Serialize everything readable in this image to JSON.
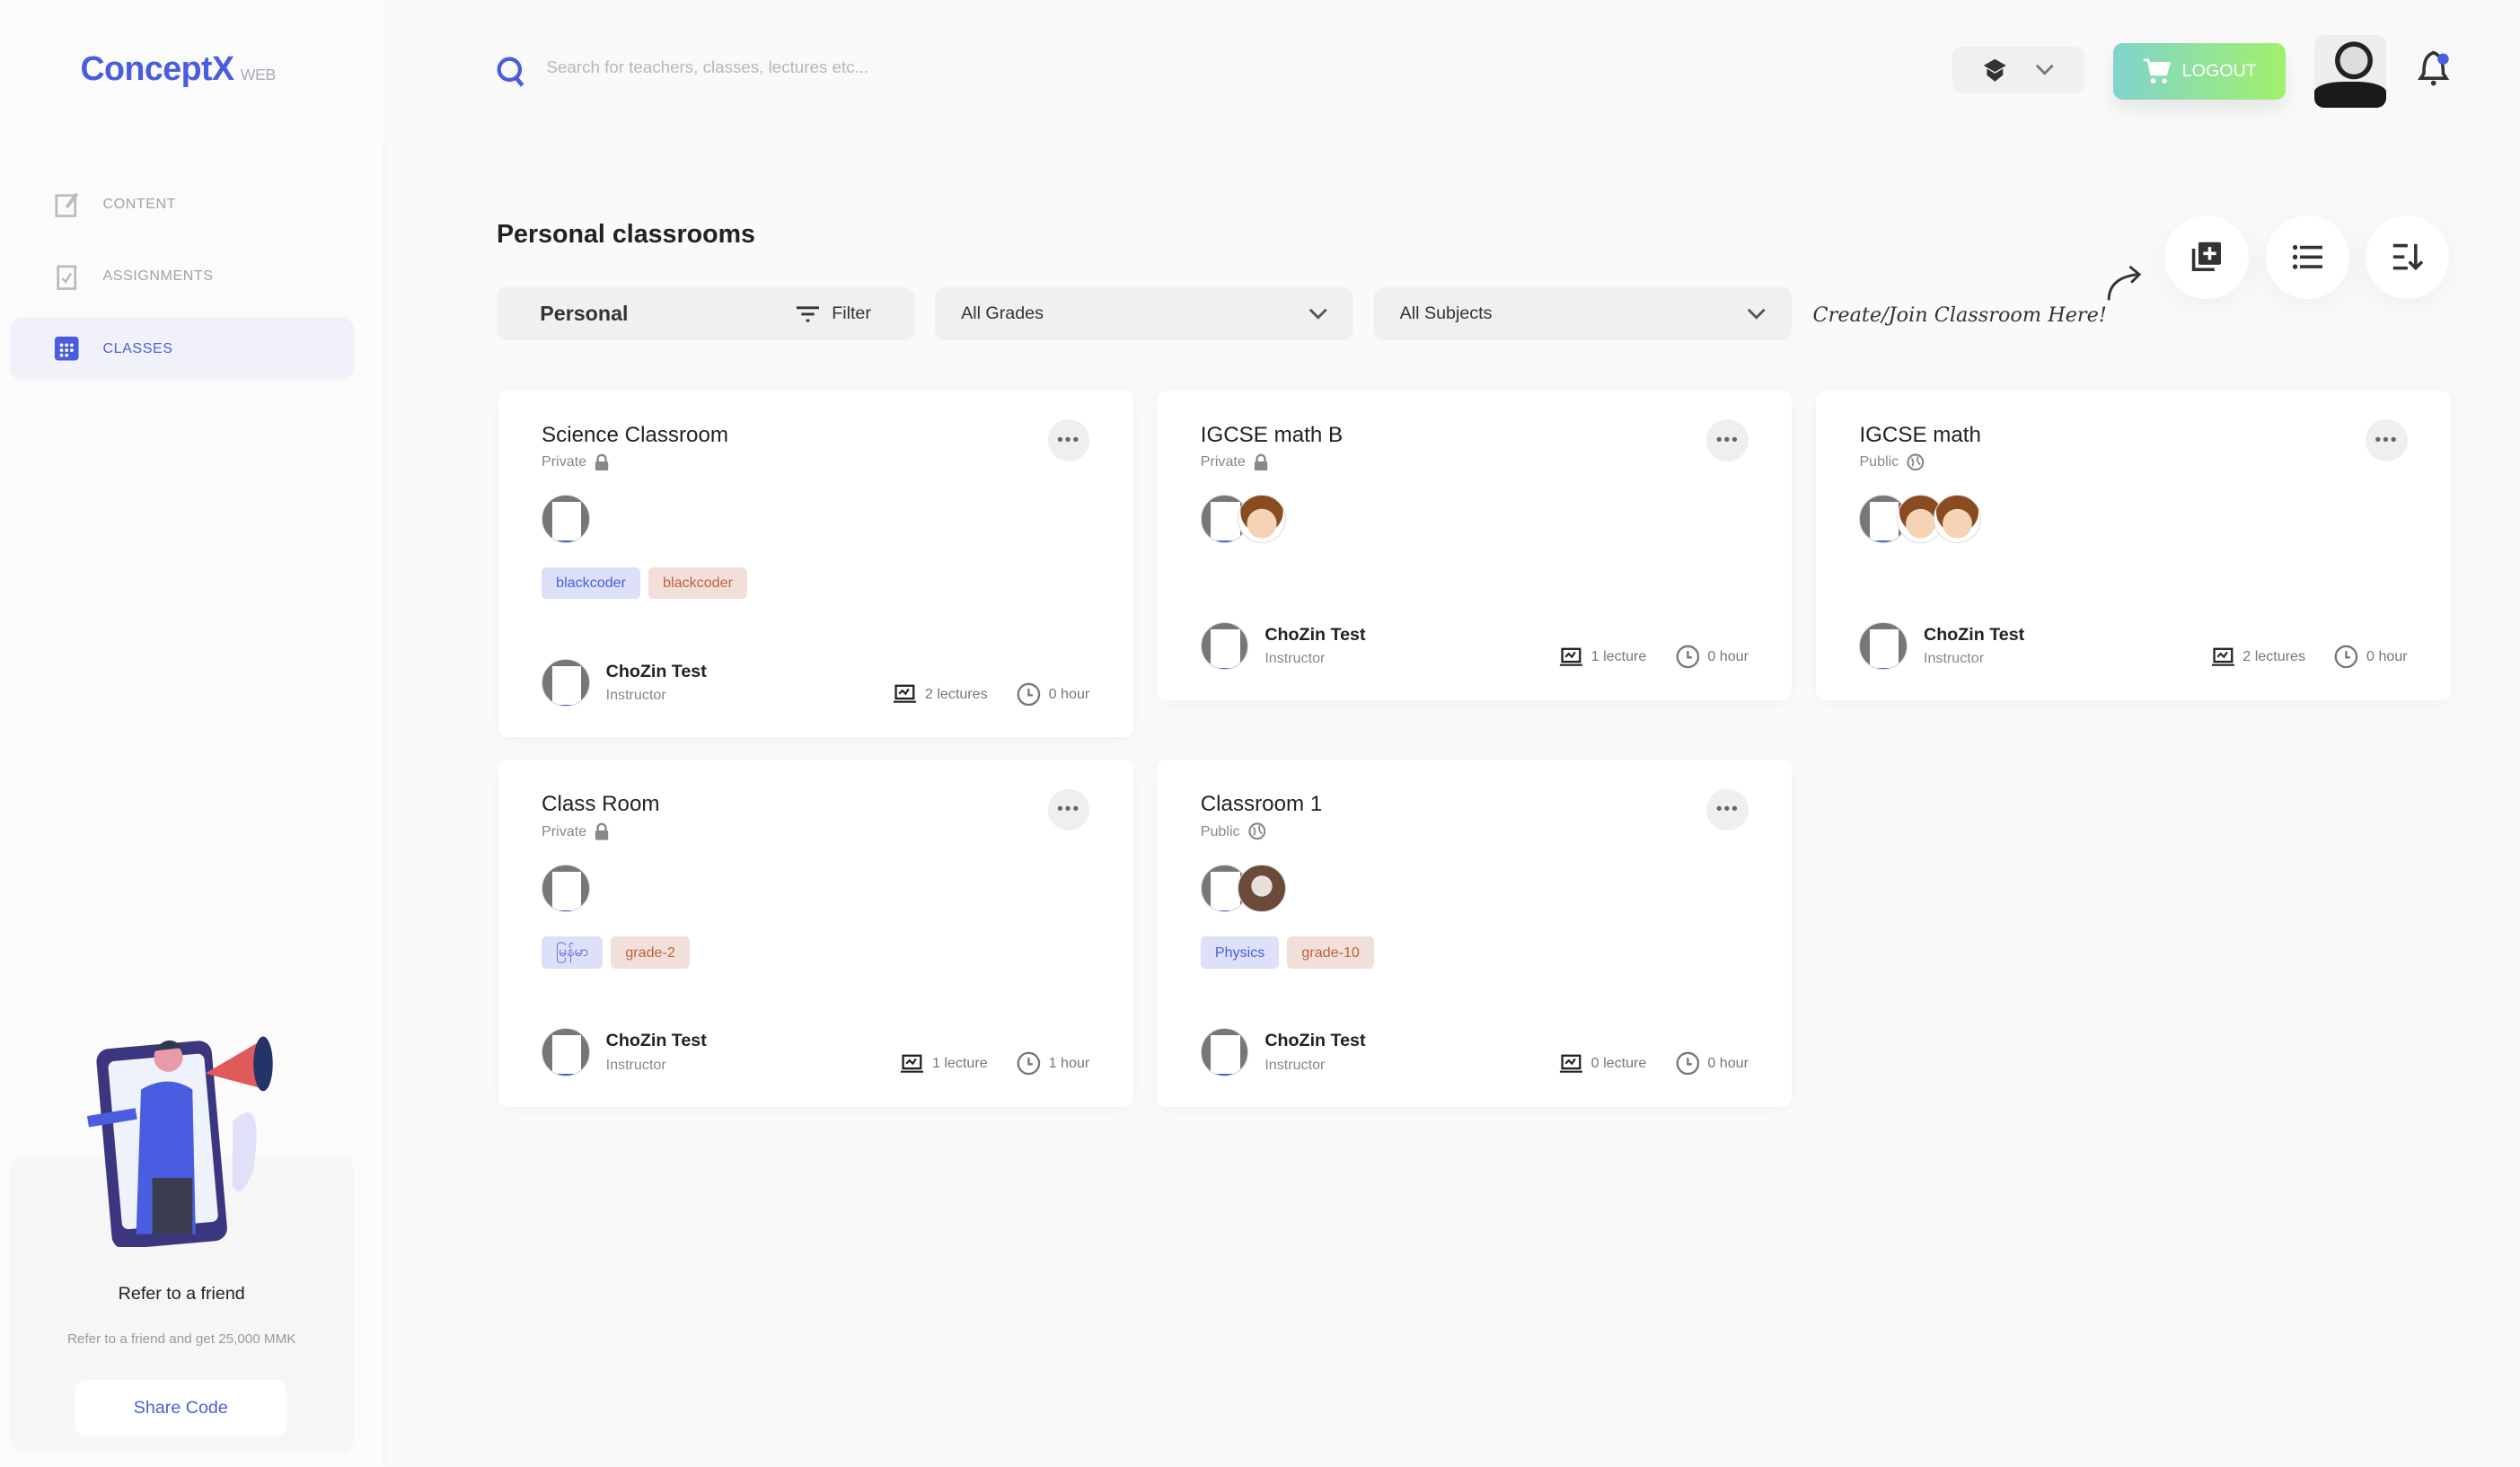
{
  "brand": {
    "name": "ConceptX",
    "suffix": "WEB"
  },
  "sidebar": {
    "items": [
      {
        "label": "CONTENT"
      },
      {
        "label": "ASSIGNMENTS"
      },
      {
        "label": "CLASSES",
        "active": true
      }
    ],
    "refer": {
      "title": "Refer to a friend",
      "subtitle": "Refer to a friend and get 25,000 MMK",
      "button": "Share Code"
    }
  },
  "header": {
    "search_placeholder": "Search for teachers, classes, lectures etc...",
    "logout": "LOGOUT"
  },
  "main": {
    "title": "Personal classrooms",
    "filter": {
      "scope": "Personal",
      "filter_label": "Filter",
      "grades": "All Grades",
      "subjects": "All Subjects"
    },
    "hint": "Create/Join Classroom Here!",
    "cards": [
      {
        "title": "Science Classroom",
        "visibility": "Private",
        "avatars": [
          "shot"
        ],
        "tags": [
          {
            "text": "blackcoder",
            "color": "blue"
          },
          {
            "text": "blackcoder",
            "color": "red"
          }
        ],
        "instructor": "ChoZin Test",
        "role": "Instructor",
        "lectures": "2 lectures",
        "hours": "0 hour"
      },
      {
        "title": "IGCSE math B",
        "visibility": "Private",
        "avatars": [
          "shot",
          "face"
        ],
        "tags": [],
        "instructor": "ChoZin Test",
        "role": "Instructor",
        "lectures": "1 lecture",
        "hours": "0 hour"
      },
      {
        "title": "IGCSE math",
        "visibility": "Public",
        "avatars": [
          "shot",
          "face",
          "face"
        ],
        "tags": [],
        "instructor": "ChoZin Test",
        "role": "Instructor",
        "lectures": "2 lectures",
        "hours": "0 hour"
      },
      {
        "title": "Class Room",
        "visibility": "Private",
        "avatars": [
          "shot"
        ],
        "tags": [
          {
            "text": "မြန်မာ",
            "color": "blue"
          },
          {
            "text": "grade-2",
            "color": "red"
          }
        ],
        "instructor": "ChoZin Test",
        "role": "Instructor",
        "lectures": "1 lecture",
        "hours": "1 hour"
      },
      {
        "title": "Classroom 1",
        "visibility": "Public",
        "avatars": [
          "shot",
          "photo"
        ],
        "tags": [
          {
            "text": "Physics",
            "color": "blue"
          },
          {
            "text": "grade-10",
            "color": "red"
          }
        ],
        "instructor": "ChoZin Test",
        "role": "Instructor",
        "lectures": "0 lecture",
        "hours": "0 hour"
      }
    ]
  },
  "colors": {
    "accent": "#4a5de0",
    "tag_blue_bg": "#dde0f8",
    "tag_red_bg": "#f1e0da"
  }
}
